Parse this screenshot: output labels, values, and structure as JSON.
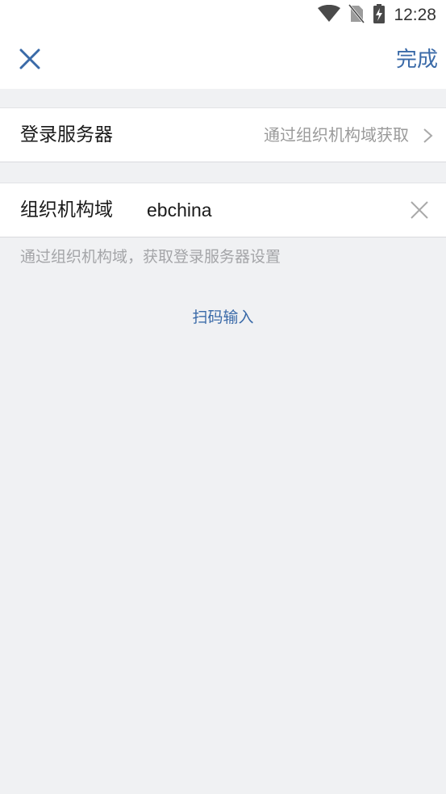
{
  "status_bar": {
    "time": "12:28",
    "icons": [
      "wifi-icon",
      "no-sim-icon",
      "battery-charging-icon"
    ]
  },
  "nav": {
    "close_icon": "close-icon",
    "done_label": "完成"
  },
  "server_row": {
    "label": "登录服务器",
    "value": "通过组织机构域获取",
    "icon": "chevron-right-icon"
  },
  "domain_row": {
    "label": "组织机构域",
    "input_value": "ebchina",
    "clear_icon": "clear-icon"
  },
  "hint_text": "通过组织机构域，获取登录服务器设置",
  "scan_label": "扫码输入",
  "colors": {
    "accent": "#3a6aa8",
    "background": "#f0f1f3",
    "surface": "#ffffff",
    "secondary_text": "#9a9a9a"
  }
}
